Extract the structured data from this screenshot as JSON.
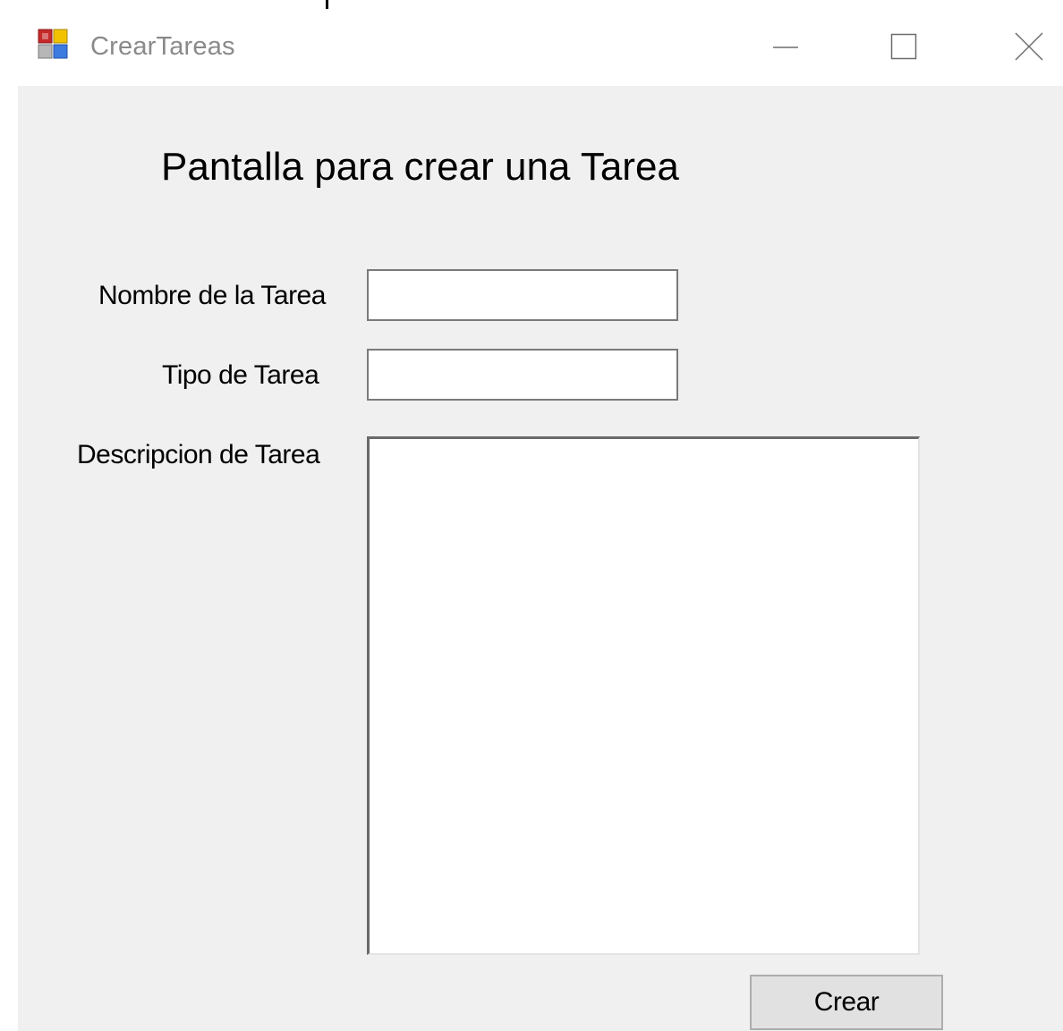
{
  "window": {
    "title": "CrearTareas",
    "controls": {
      "minimize": "minimize-icon",
      "maximize": "maximize-icon",
      "close": "close-icon"
    }
  },
  "form": {
    "heading": "Pantalla para crear una Tarea",
    "fields": {
      "nombre": {
        "label": "Nombre de la Tarea",
        "value": ""
      },
      "tipo": {
        "label": "Tipo de Tarea",
        "value": ""
      },
      "descripcion": {
        "label": "Descripcion de Tarea",
        "value": ""
      }
    },
    "submit_label": "Crear"
  },
  "colors": {
    "window_background": "#f0f0f0",
    "titlebar_background": "#ffffff",
    "title_text": "#8a8a8a",
    "button_background": "#e1e1e1"
  }
}
